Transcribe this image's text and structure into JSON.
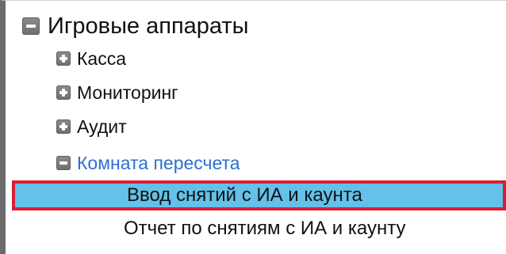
{
  "tree": {
    "root": {
      "label": "Игровые аппараты",
      "state": "expanded"
    },
    "children": [
      {
        "label": "Касса",
        "state": "collapsed",
        "highlighted": false
      },
      {
        "label": "Мониторинг",
        "state": "collapsed",
        "highlighted": false
      },
      {
        "label": "Аудит",
        "state": "collapsed",
        "highlighted": false
      },
      {
        "label": "Комната пересчета",
        "state": "expanded",
        "highlighted": true
      }
    ],
    "leaves": [
      {
        "label": "Ввод снятий с ИА и каунта",
        "selected": true
      },
      {
        "label": "Отчет по снятиям с ИА и каунту",
        "selected": false
      }
    ]
  },
  "colors": {
    "accent_text": "#2f6fd1",
    "selection_background": "#63c1ea",
    "selection_outline": "#d61f36",
    "frame_border": "#6b6b6b",
    "toggle_fill": "#7f7f7f"
  },
  "icons": {
    "expanded": "minus-icon",
    "collapsed": "plus-icon"
  }
}
